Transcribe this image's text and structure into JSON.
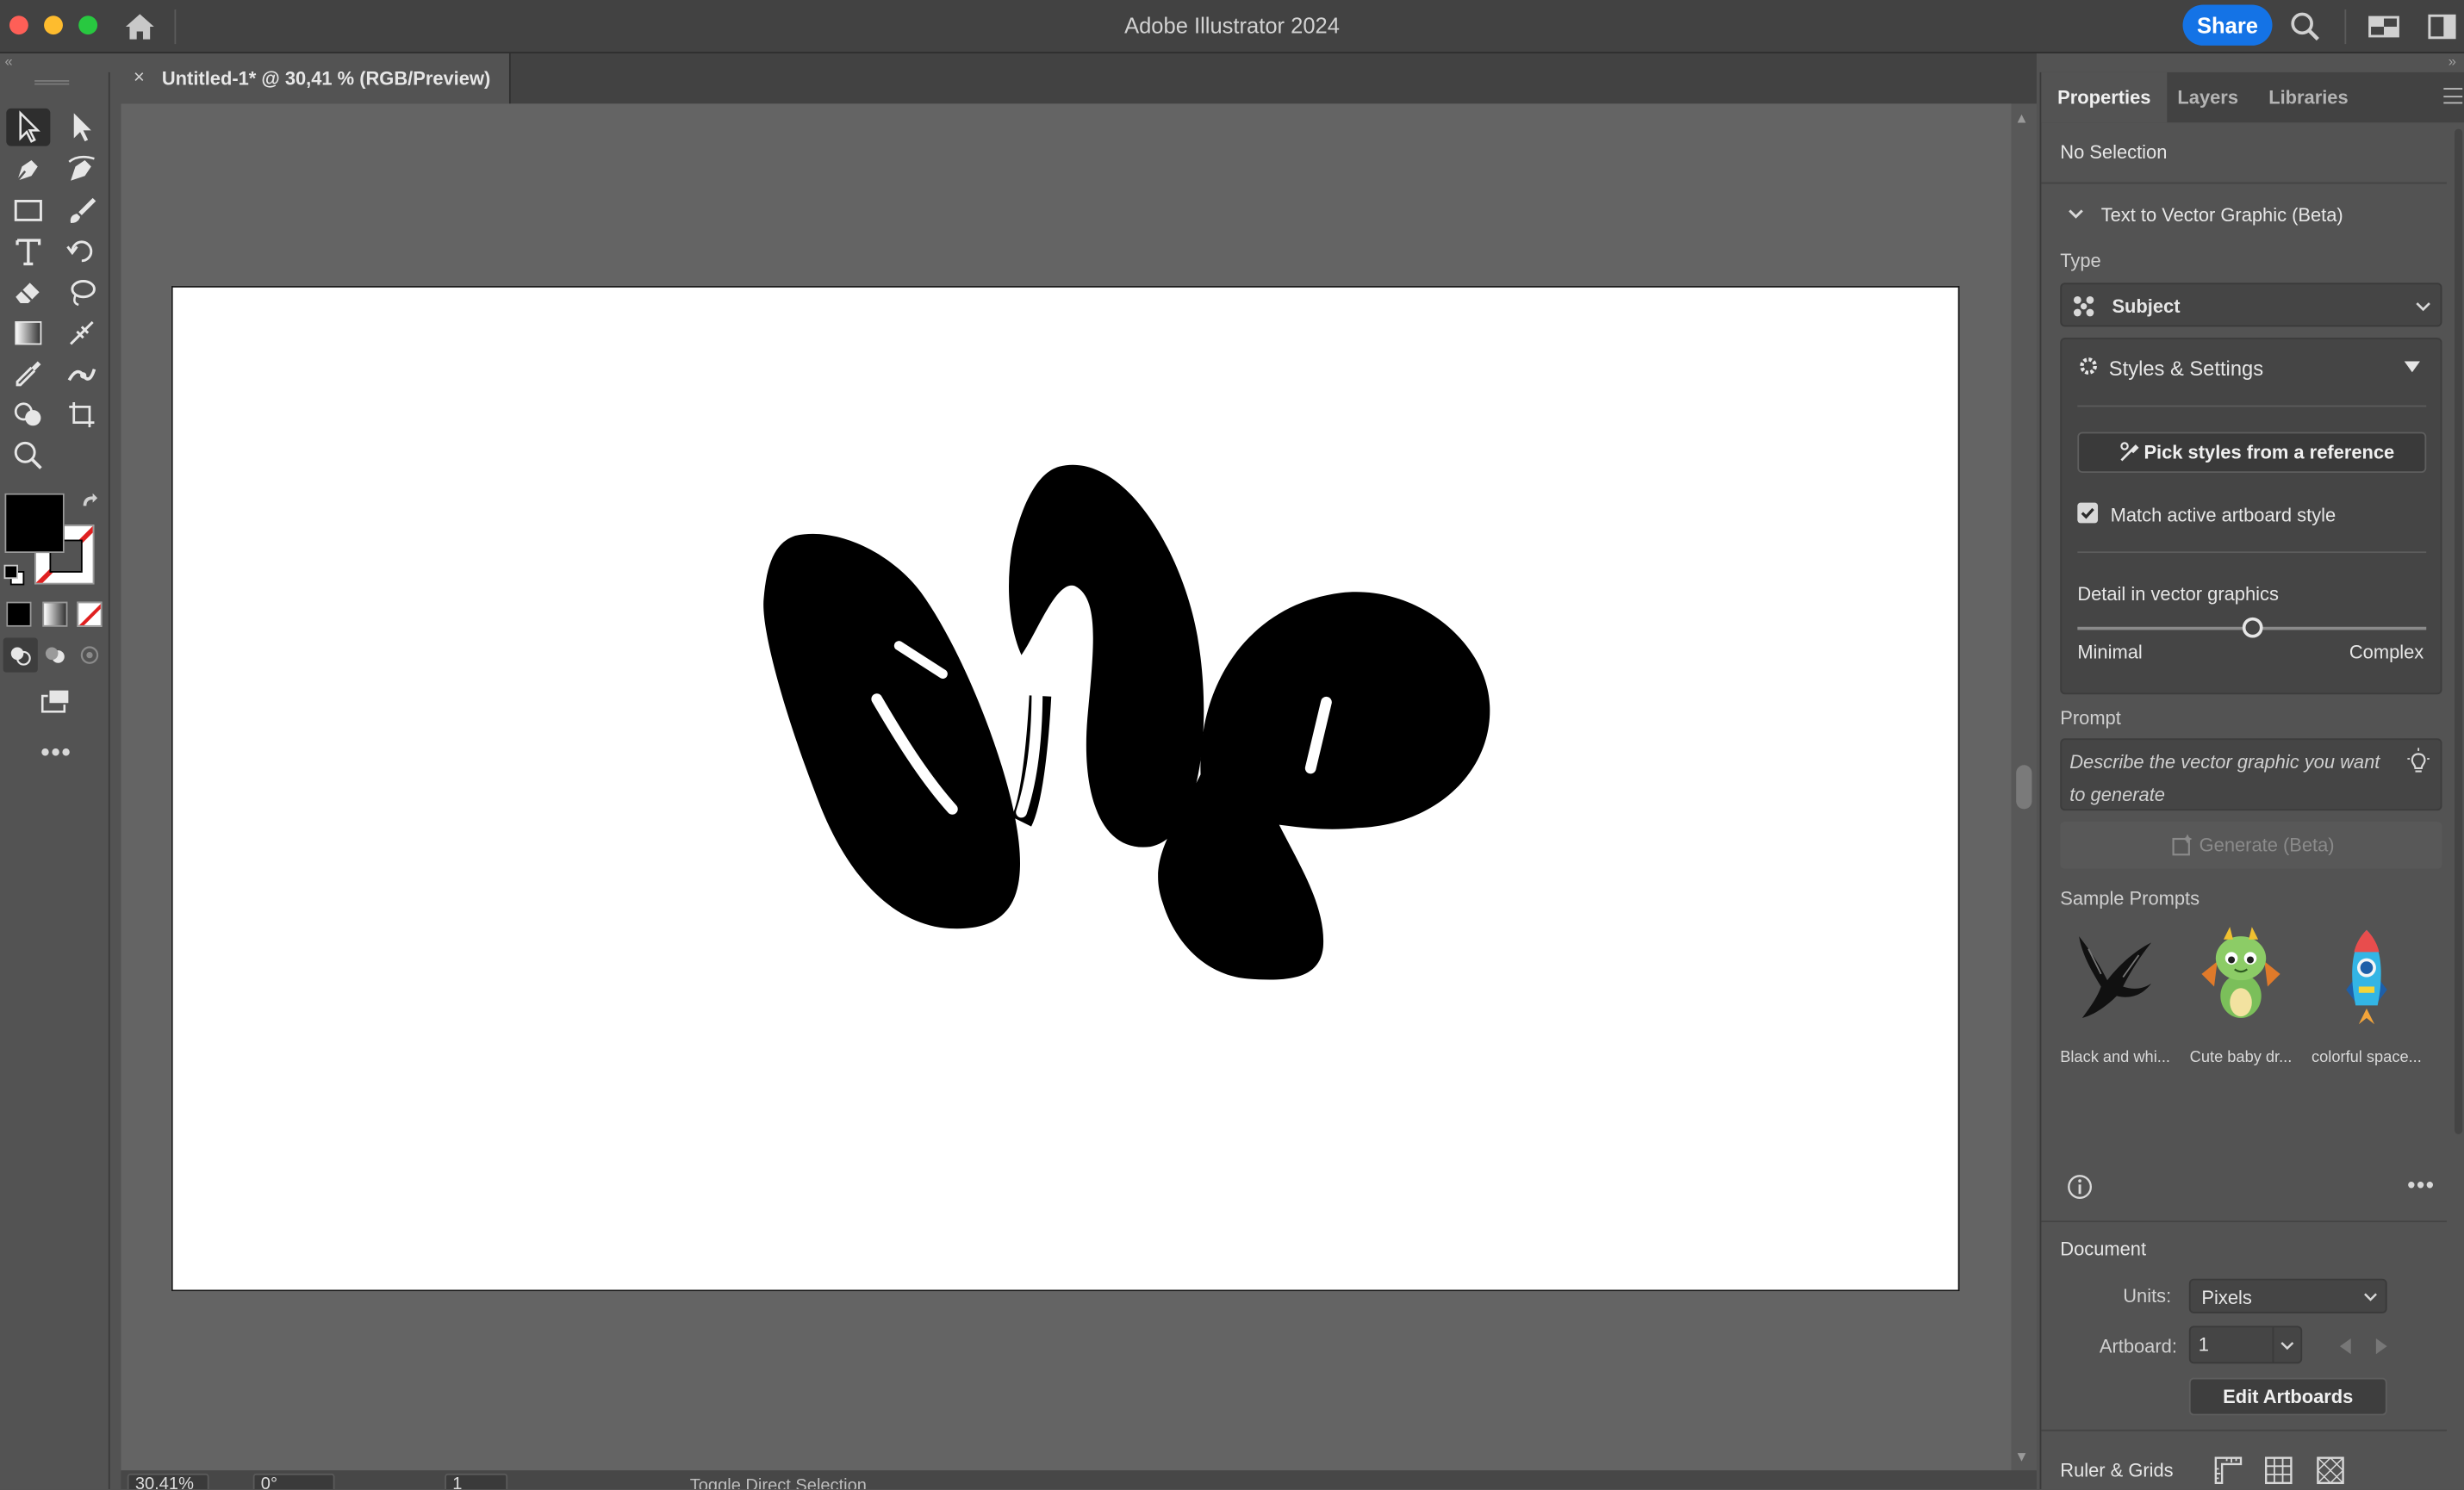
{
  "app": {
    "title": "Adobe Illustrator 2024",
    "share_label": "Share"
  },
  "document": {
    "tab_label": "Untitled-1* @ 30,41 % (RGB/Preview)",
    "close_glyph": "×"
  },
  "status_bar": {
    "zoom": "30,41%",
    "rotation": "0°",
    "artboard_number": "1",
    "status_text": "Toggle Direct Selection"
  },
  "panel": {
    "tabs": [
      "Properties",
      "Layers",
      "Libraries"
    ],
    "active_tab": "Properties",
    "selection_status": "No Selection",
    "section_title": "Text to Vector Graphic (Beta)",
    "type_label": "Type",
    "type_value": "Subject",
    "styles_settings_label": "Styles & Settings",
    "pick_styles_label": "Pick styles from a reference",
    "match_style_label": "Match active artboard style",
    "match_style_checked": true,
    "detail_label": "Detail in vector graphics",
    "detail_min_label": "Minimal",
    "detail_max_label": "Complex",
    "detail_level": 0.5,
    "prompt_label": "Prompt",
    "prompt_placeholder": "Describe the vector graphic you want to generate",
    "generate_label": "Generate (Beta)",
    "sample_prompts_label": "Sample Prompts",
    "samples": [
      {
        "label": "Black and whi...",
        "icon": "bird-icon"
      },
      {
        "label": "Cute baby dr...",
        "icon": "baby-dragon-icon"
      },
      {
        "label": "colorful space...",
        "icon": "rocket-icon"
      }
    ],
    "document_label": "Document",
    "units_label": "Units:",
    "units_value": "Pixels",
    "artboard_label": "Artboard:",
    "artboard_value": "1",
    "edit_artboards_label": "Edit Artboards",
    "ruler_grids_label": "Ruler & Grids"
  },
  "colors": {
    "accent": "#1473e6",
    "fill": "#000000",
    "stroke_none": "#e02020",
    "artboard": "#ffffff",
    "canvas": "#646464",
    "panel": "#535353"
  }
}
